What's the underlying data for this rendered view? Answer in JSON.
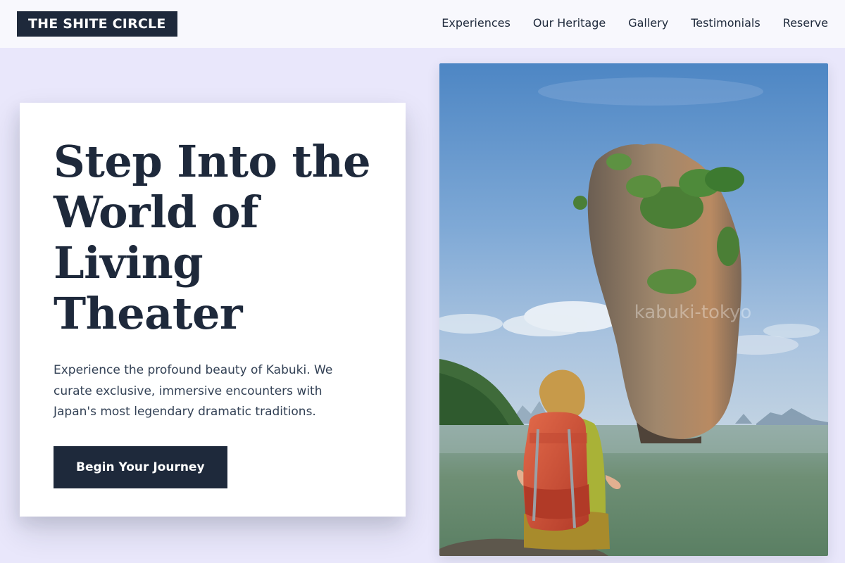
{
  "brand": {
    "name": "THE SHITE CIRCLE"
  },
  "nav": {
    "items": [
      {
        "label": "Experiences"
      },
      {
        "label": "Our Heritage"
      },
      {
        "label": "Gallery"
      },
      {
        "label": "Testimonials"
      },
      {
        "label": "Reserve"
      }
    ]
  },
  "hero": {
    "headline_lines": [
      "Step Into the",
      "World of",
      "Living",
      "Theater"
    ],
    "lead": "Experience the profound beauty of Kabuki. We curate exclusive, immersive encounters with Japan's most legendary dramatic traditions.",
    "cta_label": "Begin Your Journey",
    "image": {
      "description_icon": "landscape-photo",
      "watermark": "kabuki-tokyo"
    }
  },
  "colors": {
    "accent": "#1e293b",
    "background": "#e9e7fb",
    "header": "#f8f8fd",
    "card": "#ffffff"
  }
}
